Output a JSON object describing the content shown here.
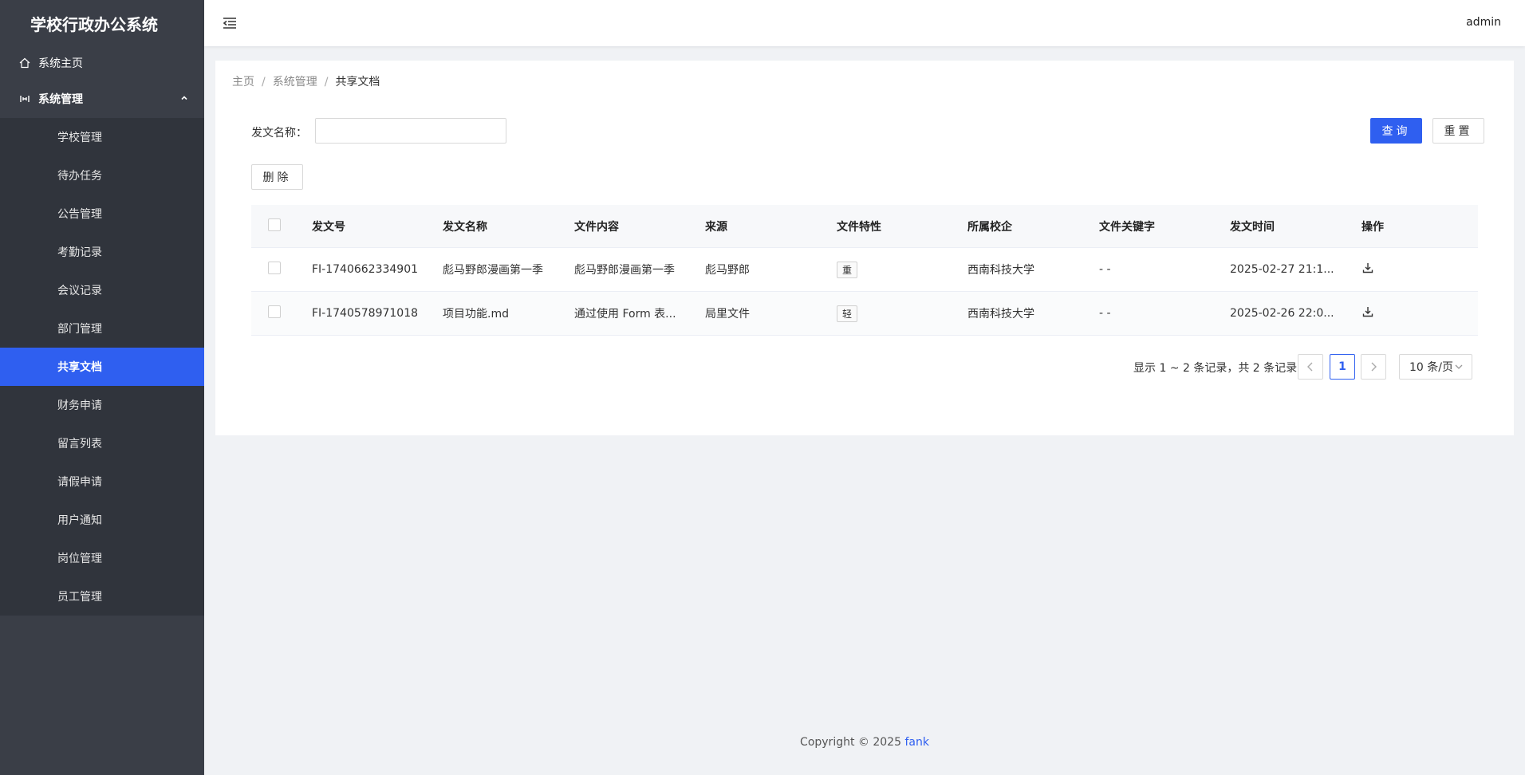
{
  "app": {
    "title": "学校行政办公系统"
  },
  "header": {
    "user": "admin"
  },
  "sidebar": {
    "home": "系统主页",
    "group": "系统管理",
    "items": [
      {
        "label": "学校管理"
      },
      {
        "label": "待办任务"
      },
      {
        "label": "公告管理"
      },
      {
        "label": "考勤记录"
      },
      {
        "label": "会议记录"
      },
      {
        "label": "部门管理"
      },
      {
        "label": "共享文档",
        "active": true
      },
      {
        "label": "财务申请"
      },
      {
        "label": "留言列表"
      },
      {
        "label": "请假申请"
      },
      {
        "label": "用户通知"
      },
      {
        "label": "岗位管理"
      },
      {
        "label": "员工管理"
      }
    ]
  },
  "breadcrumb": {
    "home": "主页",
    "section": "系统管理",
    "current": "共享文档"
  },
  "search": {
    "label": "发文名称：",
    "value": "",
    "placeholder": ""
  },
  "buttons": {
    "query": "查询",
    "reset": "重置",
    "delete": "删除"
  },
  "table": {
    "columns": [
      "发文号",
      "发文名称",
      "文件内容",
      "来源",
      "文件特性",
      "所属校企",
      "文件关键字",
      "发文时间",
      "操作"
    ],
    "rows": [
      {
        "doc_no": "FI-1740662334901",
        "name": "彪马野郎漫画第一季",
        "content": "彪马野郎漫画第一季",
        "source": "彪马野郎",
        "feature": "重",
        "school": "西南科技大学",
        "keywords": "- -",
        "time": "2025-02-27 21:1..."
      },
      {
        "doc_no": "FI-1740578971018",
        "name": "项目功能.md",
        "content": "通过使用 Form 表...",
        "source": "局里文件",
        "feature": "轻",
        "school": "西南科技大学",
        "keywords": "- -",
        "time": "2025-02-26 22:0..."
      }
    ]
  },
  "pagination": {
    "summary": "显示 1 ~ 2 条记录，共 2 条记录",
    "current_page": "1",
    "page_size": "10 条/页"
  },
  "footer": {
    "copyright": "Copyright © 2025",
    "author": "fank"
  },
  "colors": {
    "primary": "#2f5ff0",
    "sidebar": "#3a3e47",
    "submenu": "#30343c"
  }
}
